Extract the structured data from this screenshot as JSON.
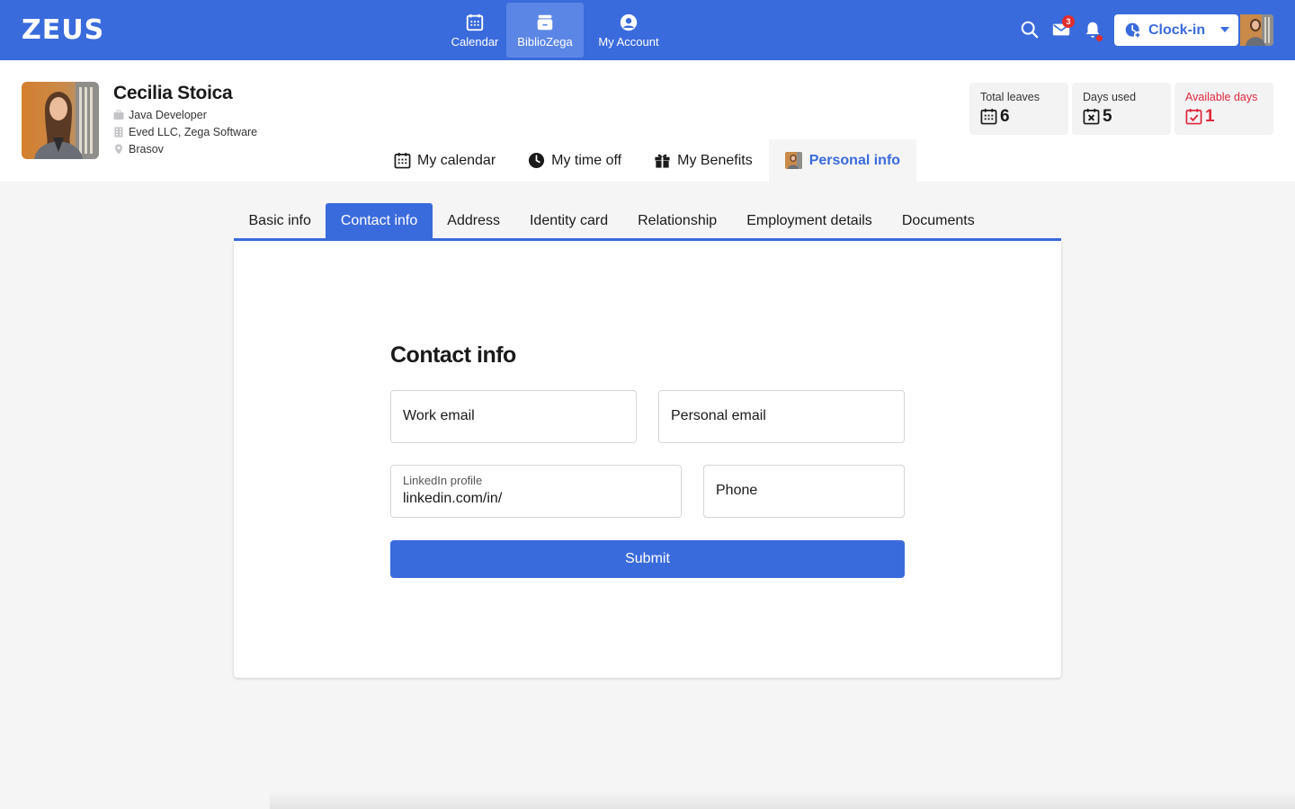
{
  "app": {
    "logo": "ZEUS",
    "brand_color": "#3a6bdc"
  },
  "nav": {
    "items": [
      {
        "label": "Calendar",
        "icon": "calendar-icon"
      },
      {
        "label": "BiblioZega",
        "icon": "archive-icon",
        "active": true
      },
      {
        "label": "My Account",
        "icon": "account-icon"
      }
    ]
  },
  "topbar": {
    "mail_count": "3",
    "clockin_label": "Clock-in"
  },
  "profile": {
    "name": "Cecilia Stoica",
    "role": "Java Developer",
    "company": "Eved LLC, Zega Software",
    "location": "Brasov"
  },
  "stats": [
    {
      "label": "Total leaves",
      "value": "6",
      "icon": "calendar-grid-icon"
    },
    {
      "label": "Days used",
      "value": "5",
      "icon": "calendar-x-icon"
    },
    {
      "label": "Available days",
      "value": "1",
      "icon": "calendar-check-icon",
      "color": "#e0283c"
    }
  ],
  "profile_tabs": [
    {
      "label": "My calendar",
      "icon": "calendar-icon"
    },
    {
      "label": "My time off",
      "icon": "clock-icon"
    },
    {
      "label": "My Benefits",
      "icon": "gift-icon"
    },
    {
      "label": "Personal info",
      "icon": "avatar",
      "active": true
    }
  ],
  "sub_tabs": [
    {
      "label": "Basic info"
    },
    {
      "label": "Contact info",
      "active": true
    },
    {
      "label": "Address"
    },
    {
      "label": "Identity card"
    },
    {
      "label": "Relationship"
    },
    {
      "label": "Employment details"
    },
    {
      "label": "Documents"
    }
  ],
  "form": {
    "title": "Contact info",
    "work_email": {
      "placeholder": "Work email",
      "value": ""
    },
    "personal_email": {
      "placeholder": "Personal email",
      "value": ""
    },
    "linkedin": {
      "label": "LinkedIn profile",
      "value": "linkedin.com/in/"
    },
    "phone": {
      "placeholder": "Phone",
      "value": ""
    },
    "submit_label": "Submit"
  }
}
